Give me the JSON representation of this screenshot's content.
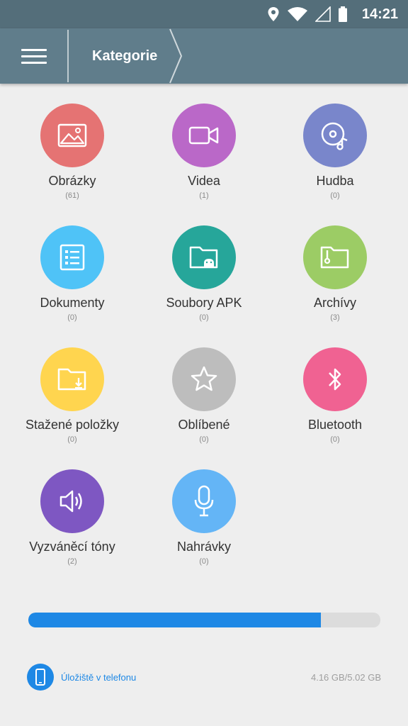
{
  "status_bar": {
    "time": "14:21",
    "icons": [
      "location-icon",
      "wifi-icon",
      "signal-icon",
      "battery-icon"
    ]
  },
  "app_bar": {
    "menu_icon": "hamburger-menu-icon",
    "breadcrumb": "Kategorie"
  },
  "categories": [
    {
      "label": "Obrázky",
      "count": "(61)",
      "color": "#e57373",
      "icon": "image-icon"
    },
    {
      "label": "Videa",
      "count": "(1)",
      "color": "#ba68c8",
      "icon": "video-camera-icon"
    },
    {
      "label": "Hudba",
      "count": "(0)",
      "color": "#7986cb",
      "icon": "music-disc-icon"
    },
    {
      "label": "Dokumenty",
      "count": "(0)",
      "color": "#4fc3f7",
      "icon": "document-list-icon"
    },
    {
      "label": "Soubory APK",
      "count": "(0)",
      "color": "#26a69a",
      "icon": "apk-folder-icon"
    },
    {
      "label": "Archívy",
      "count": "(3)",
      "color": "#9ccc65",
      "icon": "archive-folder-icon"
    },
    {
      "label": "Stažené položky",
      "count": "(0)",
      "color": "#ffd54f",
      "icon": "download-folder-icon"
    },
    {
      "label": "Oblíbené",
      "count": "(0)",
      "color": "#bdbdbd",
      "icon": "star-icon"
    },
    {
      "label": "Bluetooth",
      "count": "(0)",
      "color": "#f06292",
      "icon": "bluetooth-icon"
    },
    {
      "label": "Vyzváněcí tóny",
      "count": "(2)",
      "color": "#7e57c2",
      "icon": "speaker-icon"
    },
    {
      "label": "Nahrávky",
      "count": "(0)",
      "color": "#64b5f6",
      "icon": "microphone-icon"
    }
  ],
  "storage": {
    "used_fraction": 0.83,
    "bar_color": "#1e88e5",
    "label": "Úložiště v telefonu",
    "size": "4.16 GB/5.02 GB",
    "icon": "phone-icon"
  }
}
